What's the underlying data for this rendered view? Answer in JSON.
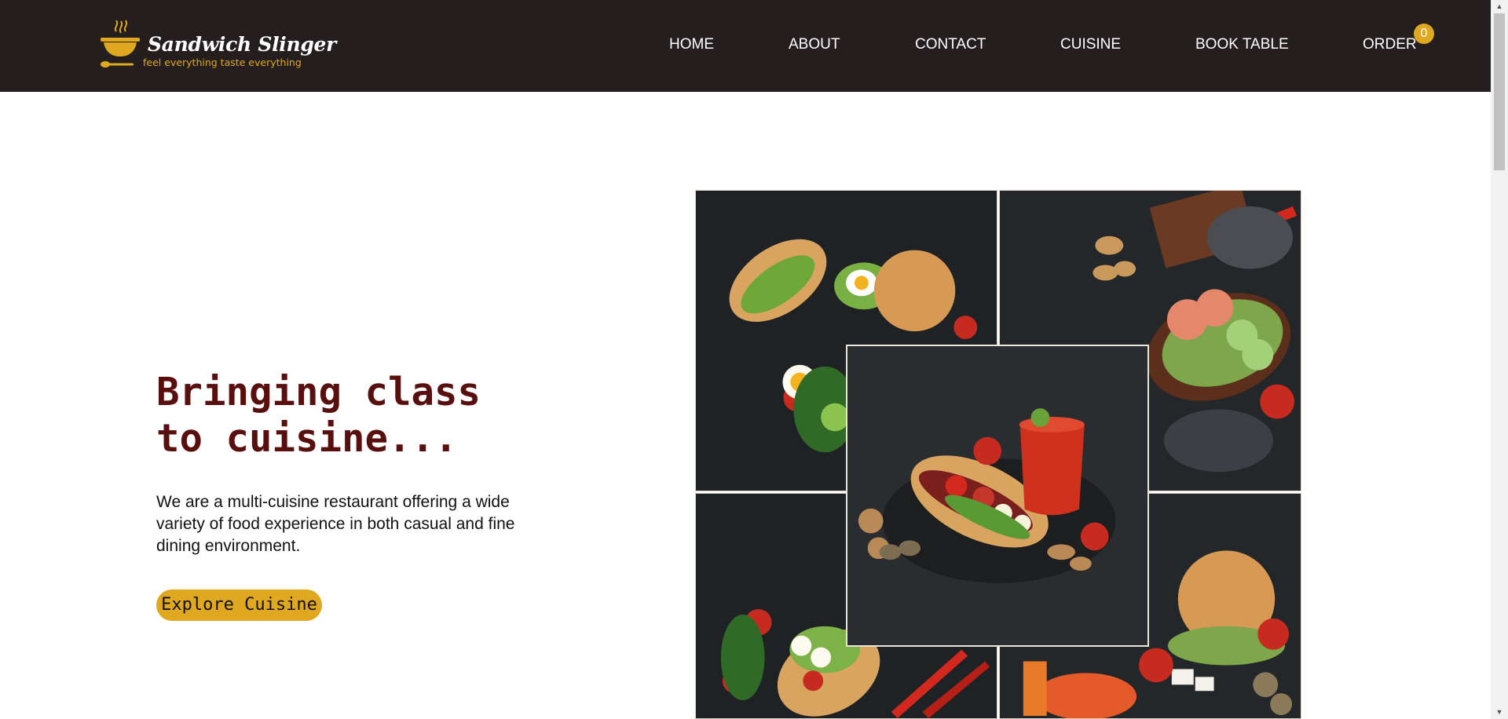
{
  "brand": {
    "name": "Sandwich Slinger",
    "tagline": "feel everything taste everything",
    "logo_icon": "steaming-bowl-icon",
    "accent_color": "#e0a820",
    "header_color": "#241e1e"
  },
  "nav": {
    "items": [
      {
        "label": "HOME"
      },
      {
        "label": "ABOUT"
      },
      {
        "label": "CONTACT"
      },
      {
        "label": "CUISINE"
      },
      {
        "label": "BOOK TABLE"
      },
      {
        "label": "ORDER"
      }
    ],
    "order_count": "0"
  },
  "hero": {
    "title_line1": "Bringing class",
    "title_line2": "to cuisine...",
    "title_color": "#5a0f0f",
    "description": "We are a multi-cuisine restaurant offering a wide variety of food experience in both casual and fine dining environment.",
    "cta_label": "Explore Cuisine"
  },
  "collage": {
    "tiles": [
      {
        "subject": "sandwiches with fried eggs and burger bun"
      },
      {
        "subject": "shrimp open sandwich with chili and peanuts"
      },
      {
        "subject": "salami baguette sandwich with tomato juice"
      },
      {
        "subject": "egg and salad sandwiches with red chili"
      },
      {
        "subject": "burger with feta salad and tomato juice"
      }
    ]
  }
}
